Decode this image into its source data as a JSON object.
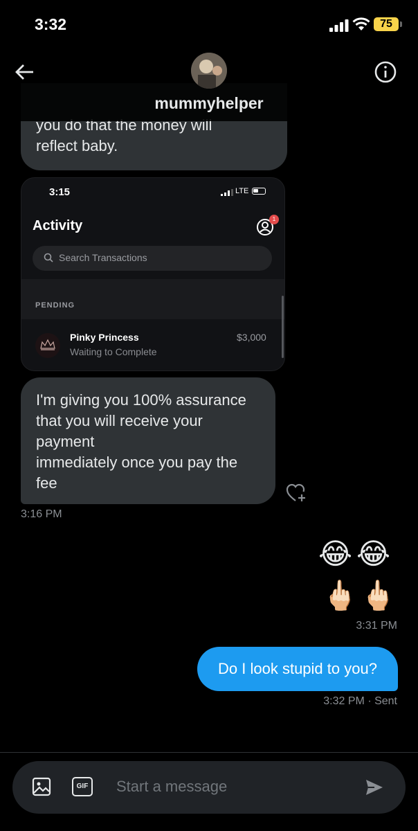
{
  "status_bar": {
    "time": "3:32",
    "battery": "75"
  },
  "header": {
    "contact_name": "mummyhelper"
  },
  "messages": {
    "top_bubble_lines": [
      "you do that the money will",
      "reflect baby."
    ],
    "screenshot": {
      "time": "3:15",
      "network": "LTE",
      "title": "Activity",
      "badge_count": "1",
      "search_placeholder": "Search Transactions",
      "section_label": "PENDING",
      "row_name": "Pinky Princess",
      "row_status": "Waiting to Complete",
      "row_amount": "$3,000"
    },
    "mid_bubble_lines": [
      "I'm giving you 100% assurance",
      "that you will receive your",
      "payment",
      "immediately once you pay the",
      "fee"
    ],
    "incoming_timestamp": "3:16 PM",
    "emoji_reply": [
      "😂",
      "😂",
      "🖕🏻",
      "🖕🏻"
    ],
    "emoji_timestamp": "3:31 PM",
    "outgoing_text": "Do I look stupid to you?",
    "outgoing_timestamp": "3:32 PM · Sent"
  },
  "composer": {
    "placeholder": "Start a message",
    "gif_label": "GIF"
  },
  "colors": {
    "accent": "#1d9bf0",
    "bubble_in": "#2f3336",
    "background": "#000000",
    "battery": "#f8d34a"
  }
}
